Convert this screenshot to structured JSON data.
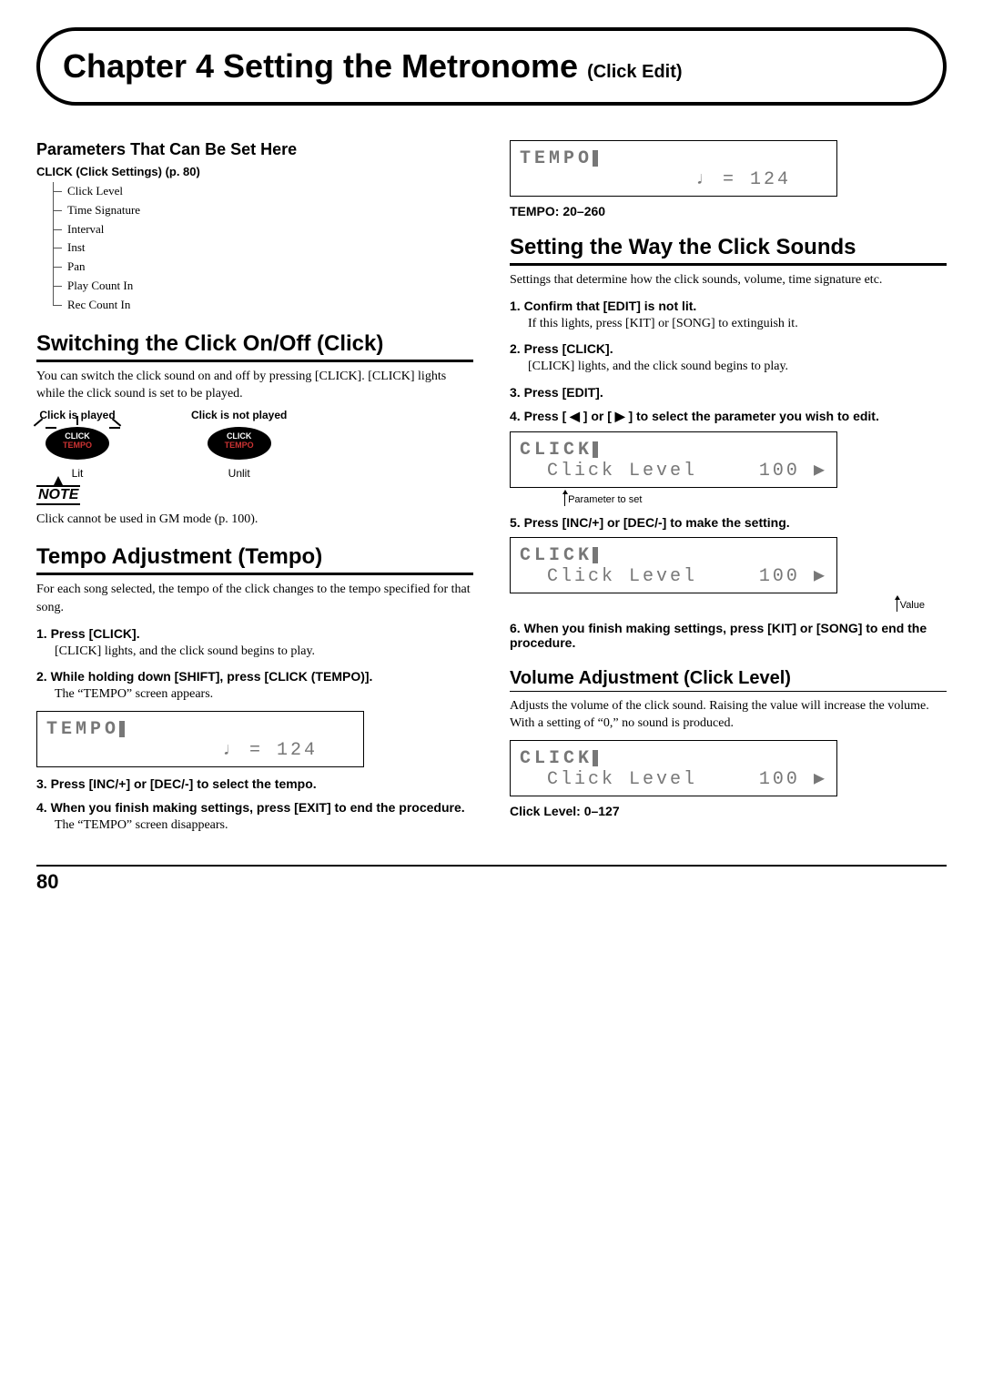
{
  "chapter": {
    "title": "Chapter 4 Setting the Metronome",
    "subtitle_small": "(Click Edit)"
  },
  "left": {
    "params_heading": "Parameters That Can Be Set Here",
    "click_heading": "CLICK (Click Settings) (p. 80)",
    "tree_items": [
      "Click Level",
      "Time Signature",
      "Interval",
      "Inst",
      "Pan",
      "Play Count In",
      "Rec Count In"
    ],
    "section_switch": "Switching the Click On/Off (Click)",
    "switch_body1": "You can switch the click sound on and off by pressing [CLICK]. [CLICK] lights while the click sound is set to be played.",
    "click_played": "Click is played",
    "click_not_played": "Click is not played",
    "oval_line1": "CLICK",
    "oval_line2": "TEMPO",
    "lit": "Lit",
    "unlit": "Unlit",
    "note_label": "NOTE",
    "note_body": "Click cannot be used in GM mode (p. 100).",
    "section_tempo": "Tempo Adjustment (Tempo)",
    "tempo_body": "For each song selected, the tempo of the click changes to the tempo specified for that song.",
    "step1": "1. Press [CLICK].",
    "step1_detail": "[CLICK] lights, and the click sound begins to play.",
    "step2": "2. While holding down [SHIFT], press [CLICK (TEMPO)].",
    "step2_detail": "The “TEMPO” screen appears.",
    "lcd_tempo_l1": "TEMPO",
    "lcd_tempo_l2": "♩ = 124",
    "step3": "3. Press [INC/+] or [DEC/-] to select the tempo.",
    "step4": "4. When you finish making settings, press [EXIT] to end the procedure.",
    "step4_detail": "The “TEMPO” screen disappears."
  },
  "right": {
    "lcd_tempo_l1": "TEMPO",
    "lcd_tempo_l2": "♩ = 124",
    "tempo_range": "TEMPO: 20–260",
    "section_way": "Setting the Way the Click Sounds",
    "way_body": "Settings that determine how the click sounds, volume, time signature etc.",
    "step1": "1. Confirm that [EDIT] is not lit.",
    "step1_detail": "If this lights, press [KIT] or [SONG] to extinguish it.",
    "step2": "2. Press [CLICK].",
    "step2_detail": "[CLICK] lights, and the click sound begins to play.",
    "step3": "3. Press [EDIT].",
    "step4": "4. Press [ ◀ ] or [ ▶ ] to select the parameter you wish to edit.",
    "lcd_click_l1": "CLICK",
    "lcd_click_l2_label": "Click Level",
    "lcd_click_l2_val": "100",
    "lcd_click_arrow": "▶",
    "annot_param": "Parameter to set",
    "step5": "5. Press [INC/+] or [DEC/-] to make the setting.",
    "annot_value": "Value",
    "step6": "6. When you finish making settings, press [KIT] or [SONG] to end the procedure.",
    "subsection_vol": "Volume Adjustment (Click Level)",
    "vol_body": "Adjusts the volume of the click sound. Raising the value will increase the volume. With a setting of “0,” no sound is produced.",
    "level_range": "Click Level: 0–127"
  },
  "page_number": "80"
}
